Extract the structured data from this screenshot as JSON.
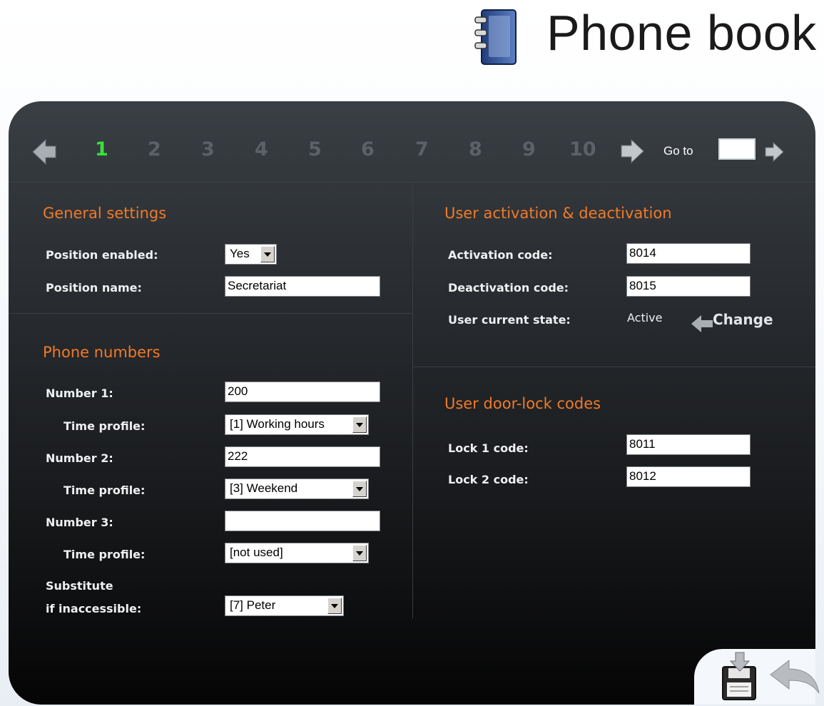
{
  "header": {
    "title": "Phone book",
    "icon": "phonebook-icon"
  },
  "pager": {
    "pages": [
      "1",
      "2",
      "3",
      "4",
      "5",
      "6",
      "7",
      "8",
      "9",
      "10"
    ],
    "active_page": "1",
    "goto_label": "Go to",
    "goto_value": "",
    "active_color": "#36e23a",
    "inactive_color": "#5b6167"
  },
  "general": {
    "title": "General settings",
    "position_enabled_label": "Position enabled:",
    "position_enabled_value": "Yes",
    "position_name_label": "Position name:",
    "position_name_value": "Secretariat"
  },
  "phones": {
    "title": "Phone numbers",
    "number1_label": "Number 1:",
    "number1_value": "200",
    "time_profile1_label": "Time profile:",
    "time_profile1_value": "[1] Working hours",
    "number2_label": "Number 2:",
    "number2_value": "222",
    "time_profile2_label": "Time profile:",
    "time_profile2_value": "[3] Weekend",
    "number3_label": "Number 3:",
    "number3_value": "",
    "time_profile3_label": "Time profile:",
    "time_profile3_value": "[not used]",
    "substitute_label_line1": "Substitute",
    "substitute_label_line2": "if inaccessible:",
    "substitute_value": "[7] Peter"
  },
  "activation": {
    "title": "User activation & deactivation",
    "activation_code_label": "Activation code:",
    "activation_code_value": "8014",
    "deactivation_code_label": "Deactivation code:",
    "deactivation_code_value": "8015",
    "current_state_label": "User current state:",
    "current_state_value": "Active",
    "change_label": "Change"
  },
  "doorlock": {
    "title": "User door-lock codes",
    "lock1_label": "Lock 1 code:",
    "lock1_value": "8011",
    "lock2_label": "Lock 2 code:",
    "lock2_value": "8012"
  },
  "actions": {
    "save_icon": "save-icon",
    "back_icon": "back-arrow-icon"
  },
  "colors": {
    "section_title": "#f07a29",
    "label": "#eef0f2",
    "panel_top": "#3a3f44",
    "panel_bottom": "#050505"
  }
}
